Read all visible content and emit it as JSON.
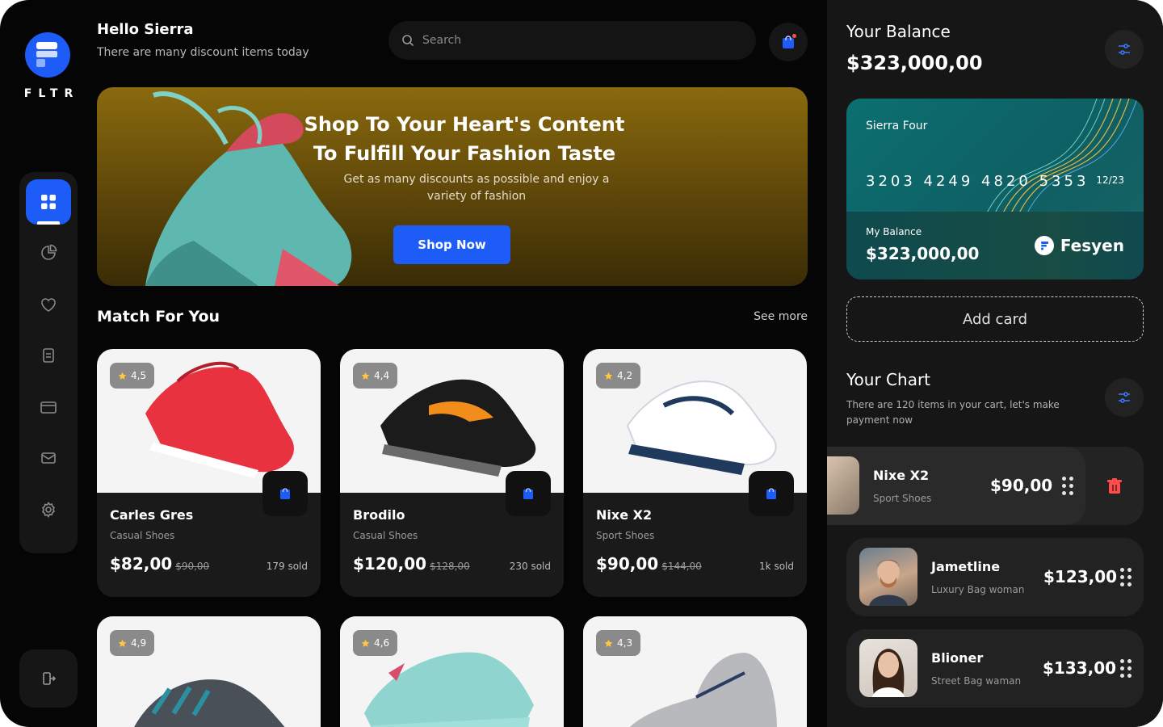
{
  "app": {
    "brand": "FLTR"
  },
  "header": {
    "greeting": "Hello Sierra",
    "subtitle": "There are many discount items today",
    "search_placeholder": "Search"
  },
  "banner": {
    "title_line1": "Shop To Your Heart's Content",
    "title_line2": "To Fulfill Your Fashion Taste",
    "subtitle_line1": "Get as many discounts as possible and enjoy a",
    "subtitle_line2": "variety of fashion",
    "button": "Shop Now"
  },
  "section": {
    "title": "Match For You",
    "see_more": "See more"
  },
  "products": [
    {
      "rating": "4,5",
      "name": "Carles Gres",
      "category": "Casual Shoes",
      "price": "$82,00",
      "old_price": "$90,00",
      "sold": "179 sold"
    },
    {
      "rating": "4,4",
      "name": "Brodilo",
      "category": "Casual Shoes",
      "price": "$120,00",
      "old_price": "$128,00",
      "sold": "230 sold"
    },
    {
      "rating": "4,2",
      "name": "Nixe X2",
      "category": "Sport Shoes",
      "price": "$90,00",
      "old_price": "$144,00",
      "sold": "1k sold"
    },
    {
      "rating": "4,9"
    },
    {
      "rating": "4,6"
    },
    {
      "rating": "4,3"
    }
  ],
  "balance": {
    "title": "Your Balance",
    "amount": "$323,000,00"
  },
  "card": {
    "holder": "Sierra Four",
    "number": "3203 4249 4820 5353",
    "expiry": "12/23",
    "balance_label": "My Balance",
    "balance_value": "$323,000,00",
    "brand": "Fesyen"
  },
  "add_card": "Add card",
  "cart": {
    "title": "Your Chart",
    "subtitle": "There are 120 items in your cart, let's make payment now",
    "items": [
      {
        "name": "Nixe X2",
        "category": "Sport Shoes",
        "price": "$90,00"
      },
      {
        "name": "Jametline",
        "category": "Luxury Bag woman",
        "price": "$123,00"
      },
      {
        "name": "Blioner",
        "category": "Street Bag waman",
        "price": "$133,00"
      }
    ]
  },
  "colors": {
    "accent": "#1d5cf6",
    "panel": "#161616",
    "danger": "#ff4d4d"
  },
  "icons": [
    "grid-icon",
    "pie-chart-icon",
    "heart-icon",
    "document-icon",
    "wallet-icon",
    "mail-icon",
    "settings-icon",
    "logout-icon",
    "search-icon",
    "shopping-bag-icon",
    "filter-icon",
    "star-icon",
    "trash-icon",
    "drag-handle-icon"
  ]
}
